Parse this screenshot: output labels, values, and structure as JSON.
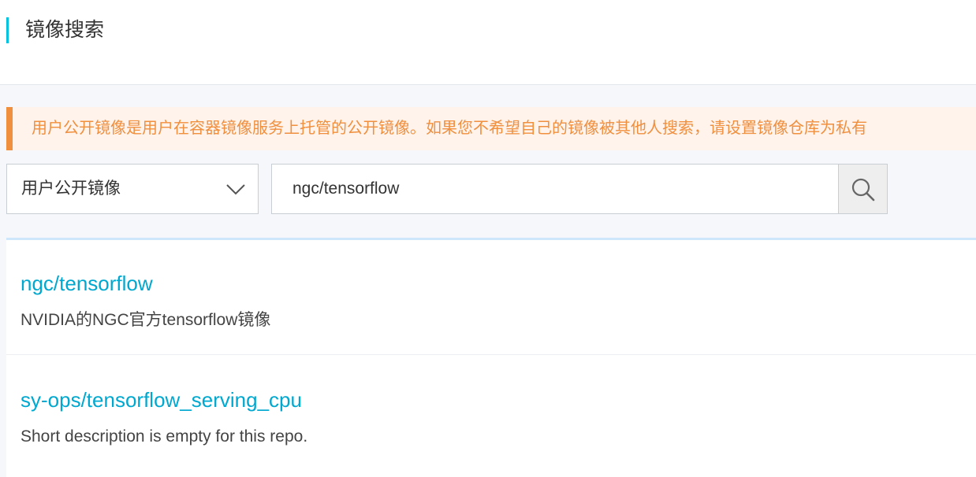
{
  "header": {
    "title": "镜像搜索"
  },
  "notice": {
    "text": "用户公开镜像是用户在容器镜像服务上托管的公开镜像。如果您不希望自己的镜像被其他人搜索，请设置镜像仓库为私有"
  },
  "search": {
    "scope_selected": "用户公开镜像",
    "query": "ngc/tensorflow"
  },
  "results": [
    {
      "name": "ngc/tensorflow",
      "description": "NVIDIA的NGC官方tensorflow镜像"
    },
    {
      "name": "sy-ops/tensorflow_serving_cpu",
      "description": "Short description is empty for this repo."
    }
  ],
  "colors": {
    "accent": "#00c1de",
    "link": "#00a8cf",
    "warning": "#f08f3e"
  },
  "icons": {
    "select_arrow": "chevron-down-icon",
    "search_button": "search-icon"
  }
}
